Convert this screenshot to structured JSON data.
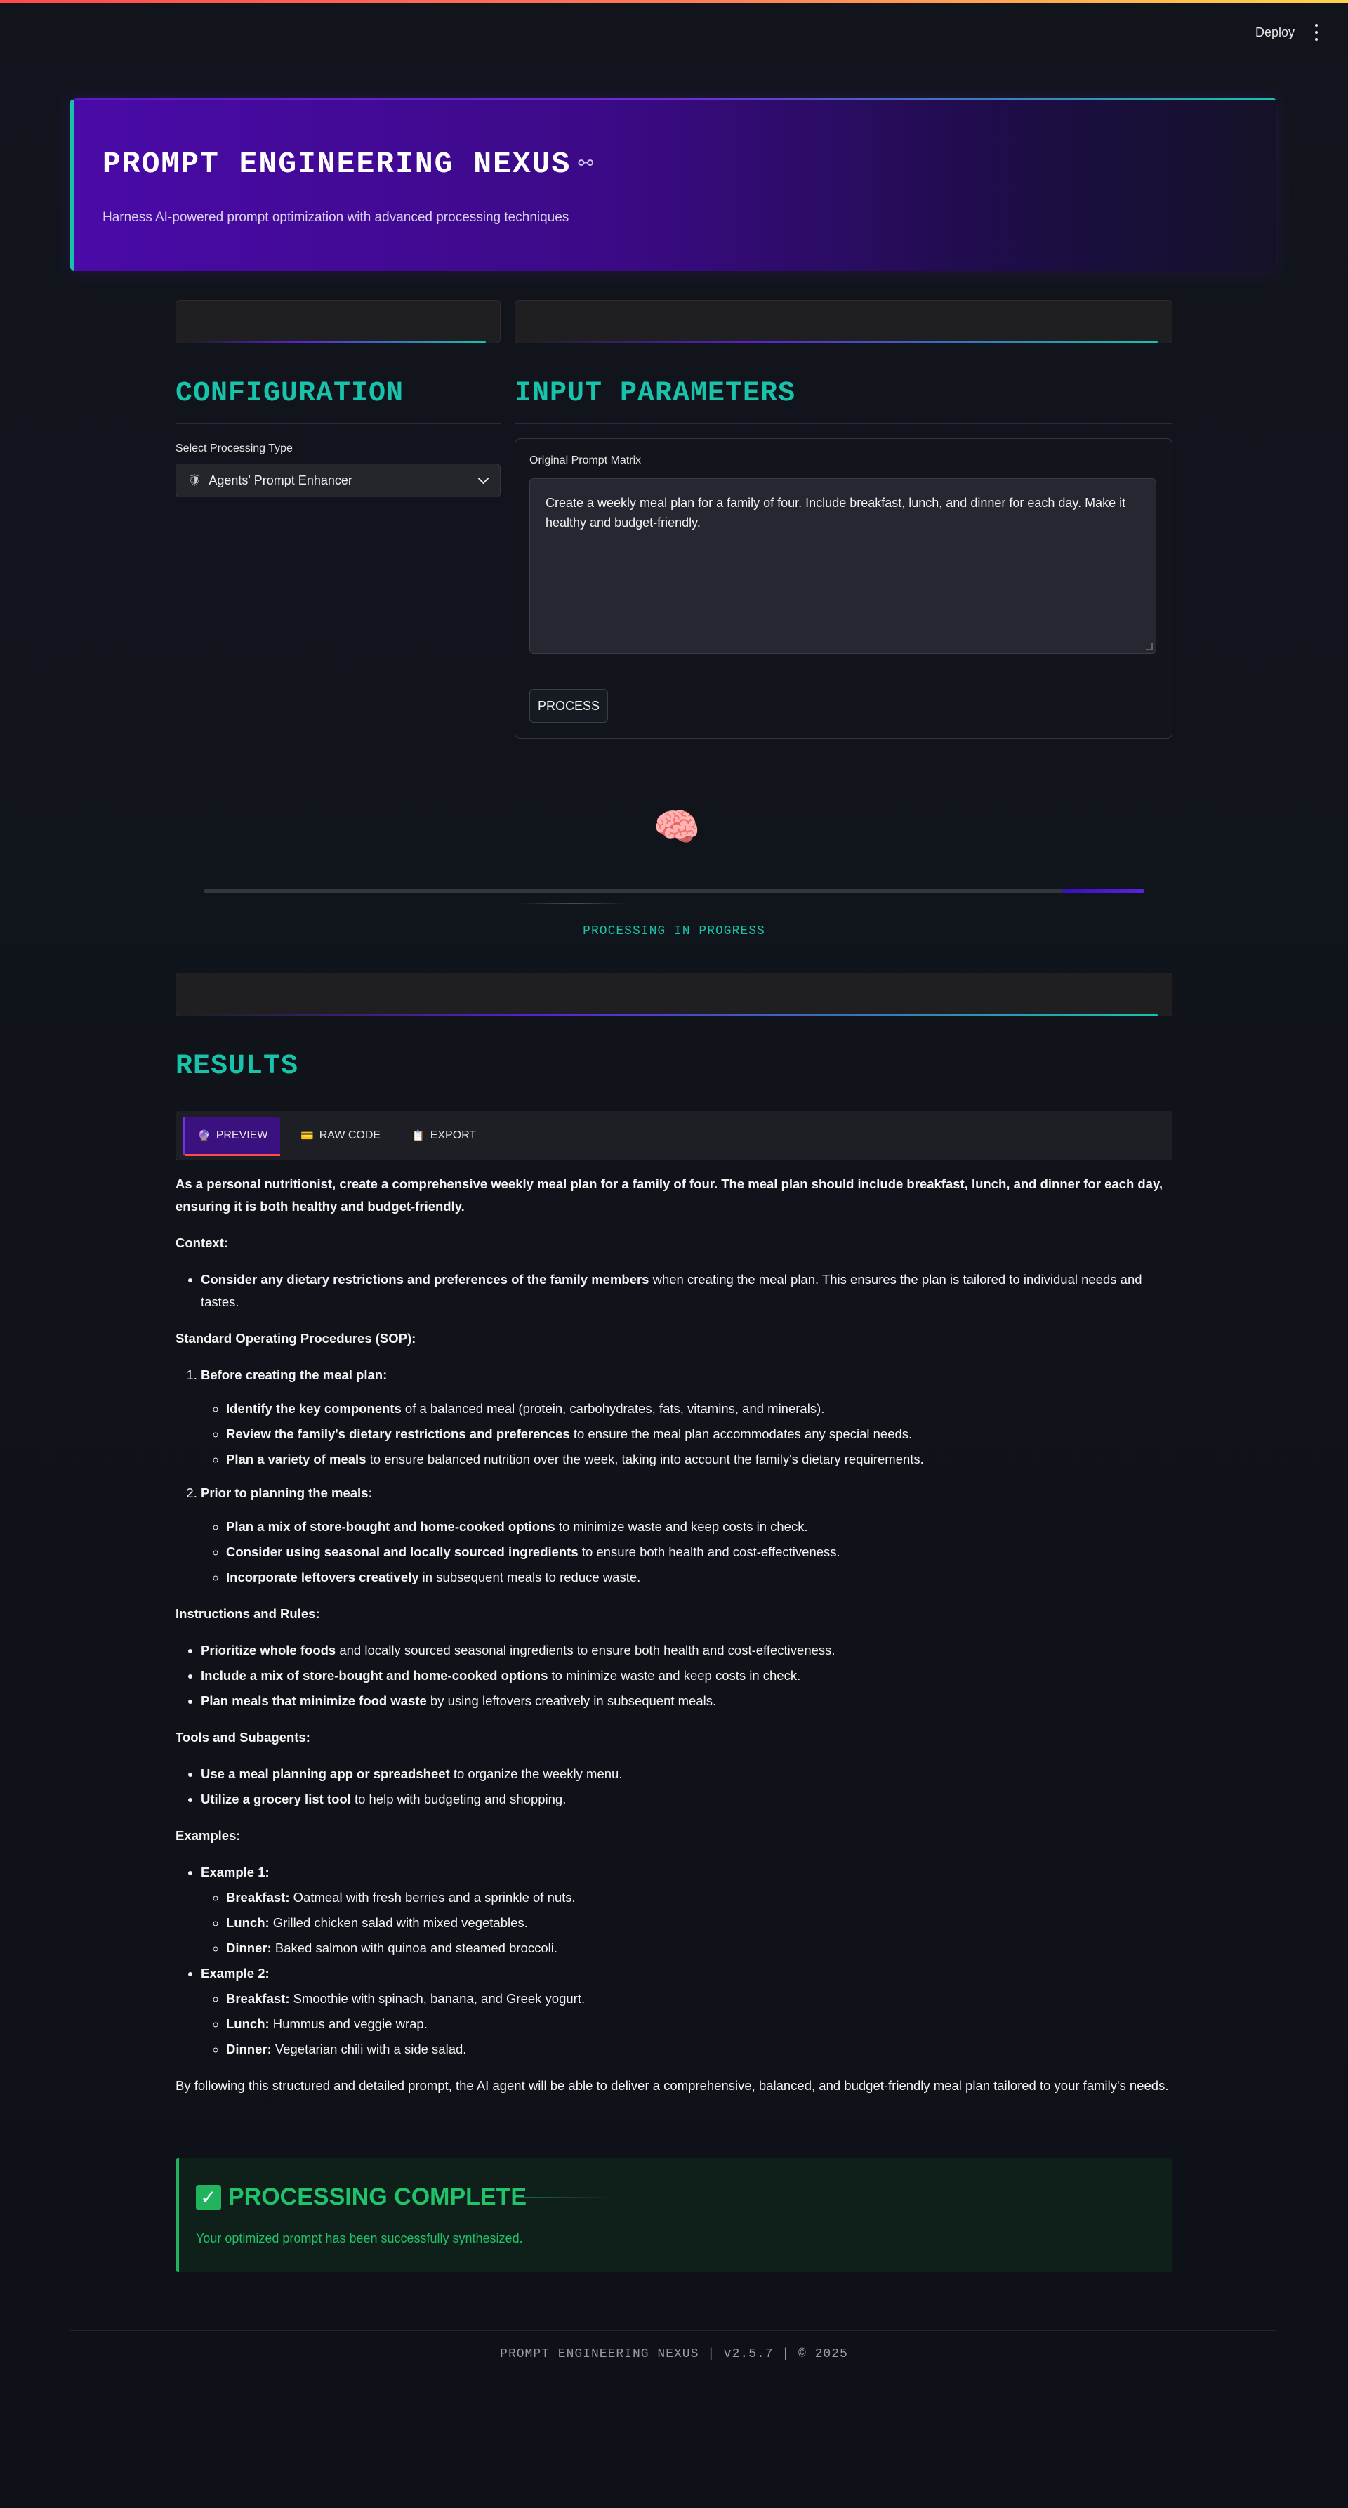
{
  "topbar": {
    "deploy_label": "Deploy",
    "menu_icon": "kebab-menu-icon"
  },
  "hero": {
    "title": "PROMPT ENGINEERING NEXUS",
    "title_icon": "link-icon",
    "subtitle": "Harness AI-powered prompt optimization with advanced processing techniques"
  },
  "config": {
    "heading": "CONFIGURATION",
    "select_label": "Select Processing Type",
    "select_value": "Agents' Prompt Enhancer",
    "select_icon": "robot-icon"
  },
  "input": {
    "heading": "INPUT PARAMETERS",
    "field_label": "Original Prompt Matrix",
    "field_value": "Create a weekly meal plan for a family of four. Include breakfast, lunch, and dinner for each day. Make it healthy and budget-friendly.",
    "button_label": "PROCESS"
  },
  "progress": {
    "icon": "brain-icon",
    "fill_start": 0.912,
    "fill_end": 1.0,
    "status": "PROCESSING IN PROGRESS"
  },
  "results": {
    "heading": "RESULTS",
    "tabs": [
      {
        "label": "PREVIEW",
        "icon": "🔮"
      },
      {
        "label": "RAW CODE",
        "icon": "💳"
      },
      {
        "label": "EXPORT",
        "icon": "📋"
      }
    ],
    "intro": "As a personal nutritionist, create a comprehensive weekly meal plan for a family of four. The meal plan should include breakfast, lunch, and dinner for each day, ensuring it is both healthy and budget-friendly.",
    "context_heading": "Context:",
    "context_bold": "Consider any dietary restrictions and preferences of the family members",
    "context_rest": " when creating the meal plan. This ensures the plan is tailored to individual needs and tastes.",
    "sop_heading": "Standard Operating Procedures (SOP):",
    "sop": [
      {
        "title": "Before creating the meal plan:",
        "items": [
          {
            "bold": "Identify the key components",
            "rest": " of a balanced meal (protein, carbohydrates, fats, vitamins, and minerals)."
          },
          {
            "bold": "Review the family's dietary restrictions and preferences",
            "rest": " to ensure the meal plan accommodates any special needs."
          },
          {
            "bold": "Plan a variety of meals",
            "rest": " to ensure balanced nutrition over the week, taking into account the family's dietary requirements."
          }
        ]
      },
      {
        "title": "Prior to planning the meals:",
        "items": [
          {
            "bold": "Plan a mix of store-bought and home-cooked options",
            "rest": " to minimize waste and keep costs in check."
          },
          {
            "bold": "Consider using seasonal and locally sourced ingredients",
            "rest": " to ensure both health and cost-effectiveness."
          },
          {
            "bold": "Incorporate leftovers creatively",
            "rest": " in subsequent meals to reduce waste."
          }
        ]
      }
    ],
    "rules_heading": "Instructions and Rules:",
    "rules": [
      {
        "bold": "Prioritize whole foods",
        "rest": " and locally sourced seasonal ingredients to ensure both health and cost-effectiveness."
      },
      {
        "bold": "Include a mix of store-bought and home-cooked options",
        "rest": " to minimize waste and keep costs in check."
      },
      {
        "bold": "Plan meals that minimize food waste",
        "rest": " by using leftovers creatively in subsequent meals."
      }
    ],
    "tools_heading": "Tools and Subagents:",
    "tools": [
      {
        "bold": "Use a meal planning app or spreadsheet",
        "rest": " to organize the weekly menu."
      },
      {
        "bold": "Utilize a grocery list tool",
        "rest": " to help with budgeting and shopping."
      }
    ],
    "examples_heading": "Examples:",
    "examples": [
      {
        "title": "Example 1:",
        "meals": [
          {
            "bold": "Breakfast:",
            "rest": " Oatmeal with fresh berries and a sprinkle of nuts."
          },
          {
            "bold": "Lunch:",
            "rest": " Grilled chicken salad with mixed vegetables."
          },
          {
            "bold": "Dinner:",
            "rest": " Baked salmon with quinoa and steamed broccoli."
          }
        ]
      },
      {
        "title": "Example 2:",
        "meals": [
          {
            "bold": "Breakfast:",
            "rest": " Smoothie with spinach, banana, and Greek yogurt."
          },
          {
            "bold": "Lunch:",
            "rest": " Hummus and veggie wrap."
          },
          {
            "bold": "Dinner:",
            "rest": " Vegetarian chili with a side salad."
          }
        ]
      }
    ],
    "closing": "By following this structured and detailed prompt, the AI agent will be able to deliver a comprehensive, balanced, and budget-friendly meal plan tailored to your family's needs."
  },
  "success": {
    "icon": "check-mark-icon",
    "title": "PROCESSING COMPLETE",
    "message": "Your optimized prompt has been successfully synthesized."
  },
  "footer": {
    "text": "PROMPT ENGINEERING NEXUS | v2.5.7 | © 2025"
  },
  "colors": {
    "accent_teal": "#19c3ab",
    "accent_purple": "#4a0aa8",
    "success_green": "#21c36a",
    "background": "#0e1117"
  }
}
